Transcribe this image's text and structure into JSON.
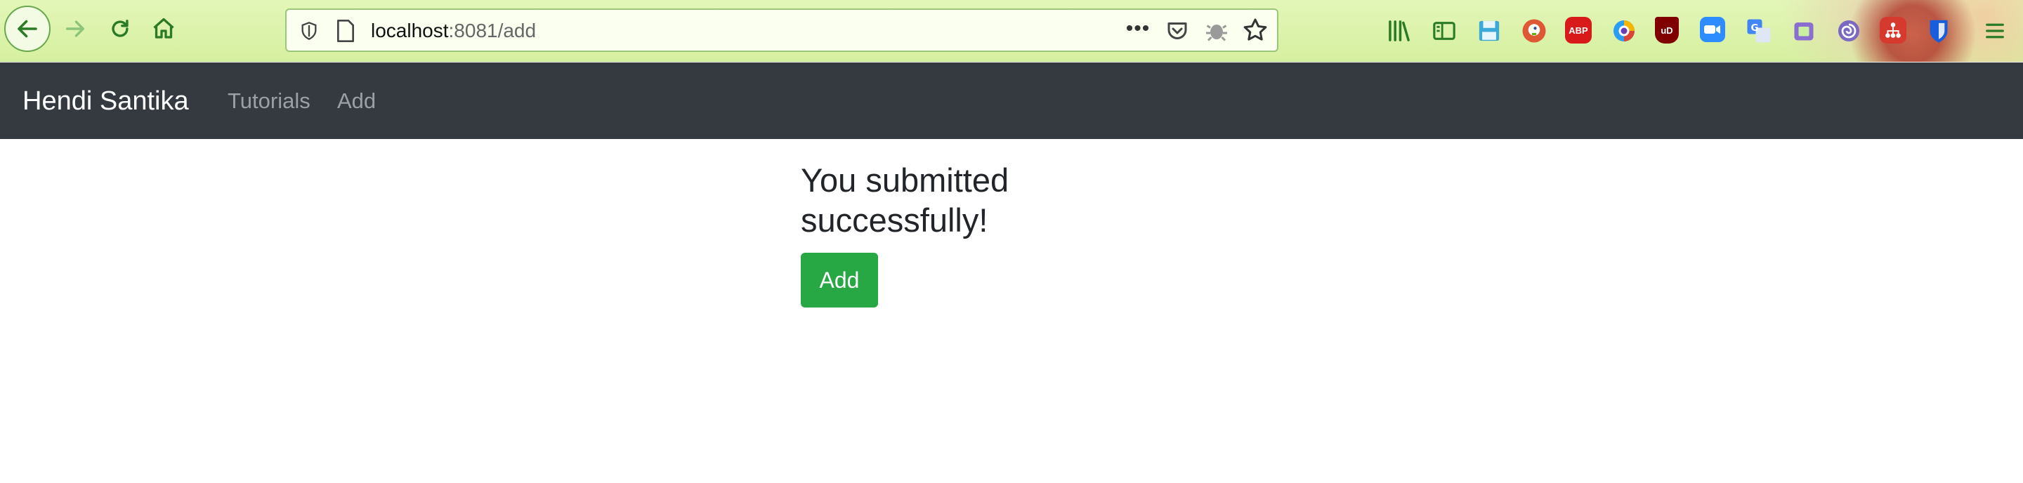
{
  "browser": {
    "url_host": "localhost",
    "url_rest": ":8081/add",
    "more_label": "•••"
  },
  "icons": [
    "back-arrow-icon",
    "forward-arrow-icon",
    "reload-icon",
    "home-icon",
    "tracking-shield-icon",
    "page-icon",
    "pocket-icon",
    "bug-icon",
    "bookmark-star-icon",
    "library-icon",
    "sidebar-icon",
    "save-icon",
    "duckduckgo-icon",
    "adblock-plus-icon",
    "color-picker-icon",
    "ublock-origin-icon",
    "zoom-icon",
    "translate-icon",
    "bitwarden-icon",
    "menu-icon"
  ],
  "extensions": {
    "abp": "ABP",
    "ublock": "uD"
  },
  "navbar": {
    "brand": "Hendi Santika",
    "links": [
      "Tutorials",
      "Add"
    ]
  },
  "main": {
    "message": "You submitted successfully!",
    "add_button": "Add"
  },
  "colors": {
    "navbar_bg": "#343a40",
    "success": "#28a745",
    "toolbar_bg": "#e3f6b8"
  }
}
